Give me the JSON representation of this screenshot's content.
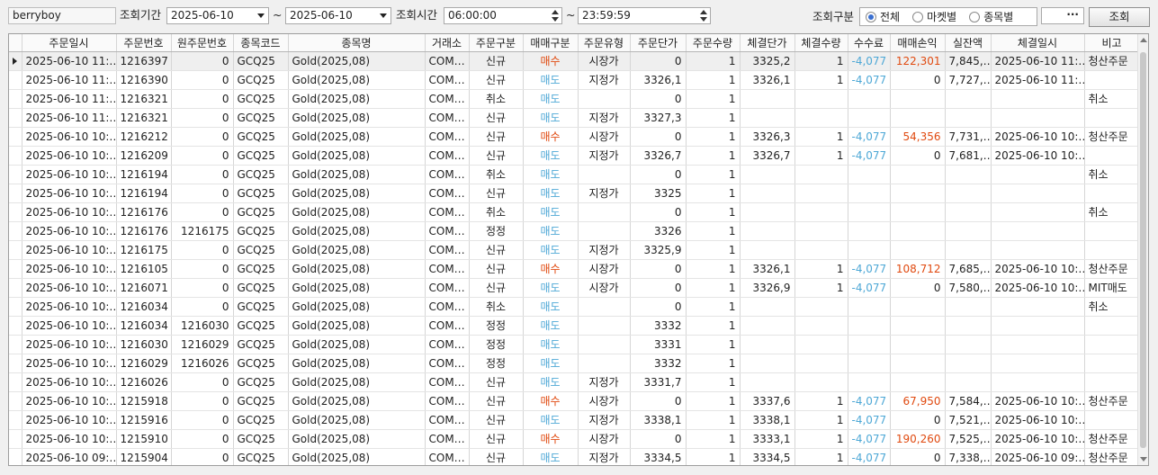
{
  "toolbar": {
    "user": "berryboy",
    "period_label": "조회기간",
    "date_from": "2025-06-10",
    "tilde1": "~",
    "date_to": "2025-06-10",
    "time_label": "조회시간",
    "time_from": "06:00:00",
    "tilde2": "~",
    "time_to": "23:59:59",
    "type_label": "조회구분",
    "radios": [
      {
        "label": "전체",
        "checked": true
      },
      {
        "label": "마켓별",
        "checked": false
      },
      {
        "label": "종목별",
        "checked": false
      }
    ],
    "more_label": "···",
    "query_label": "조회"
  },
  "table": {
    "columns": [
      "",
      "주문일시",
      "주문번호",
      "원주문번호",
      "종목코드",
      "종목명",
      "거래소",
      "주문구분",
      "매매구분",
      "주문유형",
      "주문단가",
      "주문수량",
      "체결단가",
      "체결수량",
      "수수료",
      "매매손익",
      "실잔액",
      "체결일시",
      "비고"
    ],
    "rows": [
      {
        "dt": "2025-06-10 11:…",
        "no": "1216397",
        "orig": "0",
        "code": "GCQ25",
        "name": "Gold(2025,08)",
        "ex": "COM…",
        "kind": "신규",
        "side": "매수",
        "type": "시장가",
        "price": "0",
        "qty": "1",
        "fprice": "3325,2",
        "fqty": "1",
        "fee": "-4,077",
        "pnl": "122,301",
        "bal": "7,845,…",
        "fdt": "2025-06-10 11:…",
        "note": "청산주문"
      },
      {
        "dt": "2025-06-10 11:…",
        "no": "1216390",
        "orig": "0",
        "code": "GCQ25",
        "name": "Gold(2025,08)",
        "ex": "COM…",
        "kind": "신규",
        "side": "매도",
        "type": "지정가",
        "price": "3326,1",
        "qty": "1",
        "fprice": "3326,1",
        "fqty": "1",
        "fee": "-4,077",
        "pnl": "0",
        "bal": "7,727,…",
        "fdt": "2025-06-10 11:…",
        "note": ""
      },
      {
        "dt": "2025-06-10 11:…",
        "no": "1216321",
        "orig": "0",
        "code": "GCQ25",
        "name": "Gold(2025,08)",
        "ex": "COM…",
        "kind": "취소",
        "side": "매도",
        "type": "",
        "price": "0",
        "qty": "1",
        "fprice": "",
        "fqty": "",
        "fee": "",
        "pnl": "",
        "bal": "",
        "fdt": "",
        "note": "취소"
      },
      {
        "dt": "2025-06-10 11:…",
        "no": "1216321",
        "orig": "0",
        "code": "GCQ25",
        "name": "Gold(2025,08)",
        "ex": "COM…",
        "kind": "신규",
        "side": "매도",
        "type": "지정가",
        "price": "3327,3",
        "qty": "1",
        "fprice": "",
        "fqty": "",
        "fee": "",
        "pnl": "",
        "bal": "",
        "fdt": "",
        "note": ""
      },
      {
        "dt": "2025-06-10 10:…",
        "no": "1216212",
        "orig": "0",
        "code": "GCQ25",
        "name": "Gold(2025,08)",
        "ex": "COM…",
        "kind": "신규",
        "side": "매수",
        "type": "시장가",
        "price": "0",
        "qty": "1",
        "fprice": "3326,3",
        "fqty": "1",
        "fee": "-4,077",
        "pnl": "54,356",
        "bal": "7,731,…",
        "fdt": "2025-06-10 10:…",
        "note": "청산주문"
      },
      {
        "dt": "2025-06-10 10:…",
        "no": "1216209",
        "orig": "0",
        "code": "GCQ25",
        "name": "Gold(2025,08)",
        "ex": "COM…",
        "kind": "신규",
        "side": "매도",
        "type": "지정가",
        "price": "3326,7",
        "qty": "1",
        "fprice": "3326,7",
        "fqty": "1",
        "fee": "-4,077",
        "pnl": "0",
        "bal": "7,681,…",
        "fdt": "2025-06-10 10:…",
        "note": ""
      },
      {
        "dt": "2025-06-10 10:…",
        "no": "1216194",
        "orig": "0",
        "code": "GCQ25",
        "name": "Gold(2025,08)",
        "ex": "COM…",
        "kind": "취소",
        "side": "매도",
        "type": "",
        "price": "0",
        "qty": "1",
        "fprice": "",
        "fqty": "",
        "fee": "",
        "pnl": "",
        "bal": "",
        "fdt": "",
        "note": "취소"
      },
      {
        "dt": "2025-06-10 10:…",
        "no": "1216194",
        "orig": "0",
        "code": "GCQ25",
        "name": "Gold(2025,08)",
        "ex": "COM…",
        "kind": "신규",
        "side": "매도",
        "type": "지정가",
        "price": "3325",
        "qty": "1",
        "fprice": "",
        "fqty": "",
        "fee": "",
        "pnl": "",
        "bal": "",
        "fdt": "",
        "note": ""
      },
      {
        "dt": "2025-06-10 10:…",
        "no": "1216176",
        "orig": "0",
        "code": "GCQ25",
        "name": "Gold(2025,08)",
        "ex": "COM…",
        "kind": "취소",
        "side": "매도",
        "type": "",
        "price": "0",
        "qty": "1",
        "fprice": "",
        "fqty": "",
        "fee": "",
        "pnl": "",
        "bal": "",
        "fdt": "",
        "note": "취소"
      },
      {
        "dt": "2025-06-10 10:…",
        "no": "1216176",
        "orig": "1216175",
        "code": "GCQ25",
        "name": "Gold(2025,08)",
        "ex": "COM…",
        "kind": "정정",
        "side": "매도",
        "type": "",
        "price": "3326",
        "qty": "1",
        "fprice": "",
        "fqty": "",
        "fee": "",
        "pnl": "",
        "bal": "",
        "fdt": "",
        "note": ""
      },
      {
        "dt": "2025-06-10 10:…",
        "no": "1216175",
        "orig": "0",
        "code": "GCQ25",
        "name": "Gold(2025,08)",
        "ex": "COM…",
        "kind": "신규",
        "side": "매도",
        "type": "지정가",
        "price": "3325,9",
        "qty": "1",
        "fprice": "",
        "fqty": "",
        "fee": "",
        "pnl": "",
        "bal": "",
        "fdt": "",
        "note": ""
      },
      {
        "dt": "2025-06-10 10:…",
        "no": "1216105",
        "orig": "0",
        "code": "GCQ25",
        "name": "Gold(2025,08)",
        "ex": "COM…",
        "kind": "신규",
        "side": "매수",
        "type": "시장가",
        "price": "0",
        "qty": "1",
        "fprice": "3326,1",
        "fqty": "1",
        "fee": "-4,077",
        "pnl": "108,712",
        "bal": "7,685,…",
        "fdt": "2025-06-10 10:…",
        "note": "청산주문"
      },
      {
        "dt": "2025-06-10 10:…",
        "no": "1216071",
        "orig": "0",
        "code": "GCQ25",
        "name": "Gold(2025,08)",
        "ex": "COM…",
        "kind": "신규",
        "side": "매도",
        "type": "시장가",
        "price": "0",
        "qty": "1",
        "fprice": "3326,9",
        "fqty": "1",
        "fee": "-4,077",
        "pnl": "0",
        "bal": "7,580,…",
        "fdt": "2025-06-10 10:…",
        "note": "MIT매도"
      },
      {
        "dt": "2025-06-10 10:…",
        "no": "1216034",
        "orig": "0",
        "code": "GCQ25",
        "name": "Gold(2025,08)",
        "ex": "COM…",
        "kind": "취소",
        "side": "매도",
        "type": "",
        "price": "0",
        "qty": "1",
        "fprice": "",
        "fqty": "",
        "fee": "",
        "pnl": "",
        "bal": "",
        "fdt": "",
        "note": "취소"
      },
      {
        "dt": "2025-06-10 10:…",
        "no": "1216034",
        "orig": "1216030",
        "code": "GCQ25",
        "name": "Gold(2025,08)",
        "ex": "COM…",
        "kind": "정정",
        "side": "매도",
        "type": "",
        "price": "3332",
        "qty": "1",
        "fprice": "",
        "fqty": "",
        "fee": "",
        "pnl": "",
        "bal": "",
        "fdt": "",
        "note": ""
      },
      {
        "dt": "2025-06-10 10:…",
        "no": "1216030",
        "orig": "1216029",
        "code": "GCQ25",
        "name": "Gold(2025,08)",
        "ex": "COM…",
        "kind": "정정",
        "side": "매도",
        "type": "",
        "price": "3331",
        "qty": "1",
        "fprice": "",
        "fqty": "",
        "fee": "",
        "pnl": "",
        "bal": "",
        "fdt": "",
        "note": ""
      },
      {
        "dt": "2025-06-10 10:…",
        "no": "1216029",
        "orig": "1216026",
        "code": "GCQ25",
        "name": "Gold(2025,08)",
        "ex": "COM…",
        "kind": "정정",
        "side": "매도",
        "type": "",
        "price": "3332",
        "qty": "1",
        "fprice": "",
        "fqty": "",
        "fee": "",
        "pnl": "",
        "bal": "",
        "fdt": "",
        "note": ""
      },
      {
        "dt": "2025-06-10 10:…",
        "no": "1216026",
        "orig": "0",
        "code": "GCQ25",
        "name": "Gold(2025,08)",
        "ex": "COM…",
        "kind": "신규",
        "side": "매도",
        "type": "지정가",
        "price": "3331,7",
        "qty": "1",
        "fprice": "",
        "fqty": "",
        "fee": "",
        "pnl": "",
        "bal": "",
        "fdt": "",
        "note": ""
      },
      {
        "dt": "2025-06-10 10:…",
        "no": "1215918",
        "orig": "0",
        "code": "GCQ25",
        "name": "Gold(2025,08)",
        "ex": "COM…",
        "kind": "신규",
        "side": "매수",
        "type": "시장가",
        "price": "0",
        "qty": "1",
        "fprice": "3337,6",
        "fqty": "1",
        "fee": "-4,077",
        "pnl": "67,950",
        "bal": "7,584,…",
        "fdt": "2025-06-10 10:…",
        "note": "청산주문"
      },
      {
        "dt": "2025-06-10 10:…",
        "no": "1215916",
        "orig": "0",
        "code": "GCQ25",
        "name": "Gold(2025,08)",
        "ex": "COM…",
        "kind": "신규",
        "side": "매도",
        "type": "지정가",
        "price": "3338,1",
        "qty": "1",
        "fprice": "3338,1",
        "fqty": "1",
        "fee": "-4,077",
        "pnl": "0",
        "bal": "7,521,…",
        "fdt": "2025-06-10 10:…",
        "note": ""
      },
      {
        "dt": "2025-06-10 10:…",
        "no": "1215910",
        "orig": "0",
        "code": "GCQ25",
        "name": "Gold(2025,08)",
        "ex": "COM…",
        "kind": "신규",
        "side": "매수",
        "type": "시장가",
        "price": "0",
        "qty": "1",
        "fprice": "3333,1",
        "fqty": "1",
        "fee": "-4,077",
        "pnl": "190,260",
        "bal": "7,525,…",
        "fdt": "2025-06-10 10:…",
        "note": "청산주문"
      },
      {
        "dt": "2025-06-10 09:…",
        "no": "1215904",
        "orig": "0",
        "code": "GCQ25",
        "name": "Gold(2025,08)",
        "ex": "COM…",
        "kind": "신규",
        "side": "매도",
        "type": "지정가",
        "price": "3334,5",
        "qty": "1",
        "fprice": "3334,5",
        "fqty": "1",
        "fee": "-4,077",
        "pnl": "0",
        "bal": "7,338,…",
        "fdt": "2025-06-10 09:…",
        "note": "청산주문"
      }
    ]
  }
}
